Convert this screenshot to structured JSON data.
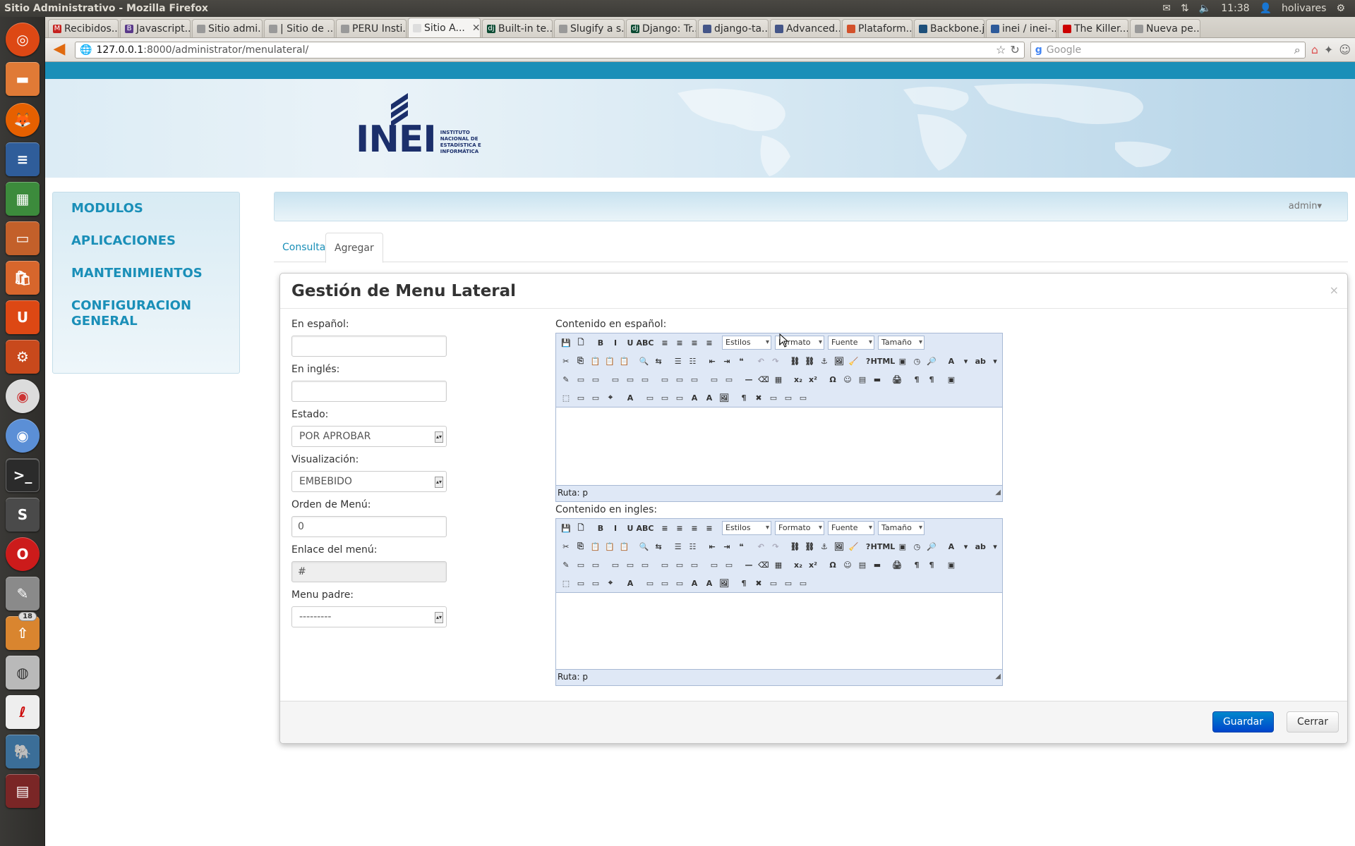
{
  "os": {
    "window_title": "Sitio Administrativo - Mozilla Firefox",
    "time": "11:38",
    "user": "holivares",
    "launcher_badge": "18"
  },
  "browser": {
    "tabs": [
      {
        "label": "Recibidos...",
        "fav": "M",
        "fav_color": "#c5221f"
      },
      {
        "label": "Javascript...",
        "fav": "B",
        "fav_color": "#5a3a8a"
      },
      {
        "label": "Sitio admi...",
        "fav": "",
        "fav_color": "#999999"
      },
      {
        "label": "| Sitio de ...",
        "fav": "",
        "fav_color": "#999999"
      },
      {
        "label": "PERU Insti...",
        "fav": "",
        "fav_color": "#999999"
      },
      {
        "label": "Sitio A...",
        "fav": "",
        "fav_color": "#dddddd",
        "active": true
      },
      {
        "label": "Built-in te...",
        "fav": "dj",
        "fav_color": "#0c4b33"
      },
      {
        "label": "Slugify a s...",
        "fav": "",
        "fav_color": "#999999"
      },
      {
        "label": "Django: Tr...",
        "fav": "dj",
        "fav_color": "#0c4b33"
      },
      {
        "label": "django-ta...",
        "fav": "",
        "fav_color": "#445588"
      },
      {
        "label": "Advanced...",
        "fav": "",
        "fav_color": "#445588"
      },
      {
        "label": "Plataform...",
        "fav": "",
        "fav_color": "#d3512b"
      },
      {
        "label": "Backbone.js",
        "fav": "",
        "fav_color": "#1d4f7a"
      },
      {
        "label": "inei / inei-...",
        "fav": "",
        "fav_color": "#2d5a9a"
      },
      {
        "label": "The Killer...",
        "fav": "",
        "fav_color": "#cc0000"
      },
      {
        "label": "Nueva pe...",
        "fav": "",
        "fav_color": "#999999"
      }
    ],
    "url_host": "127.0.0.1",
    "url_rest": ":8000/administrator/menulateral/",
    "search_placeholder": "Google"
  },
  "site": {
    "logo_text": "INEI",
    "logo_sub": "INSTITUTO NACIONAL DE ESTADÍSTICA E INFORMÁTICA",
    "sidebar": [
      {
        "label": "MODULOS"
      },
      {
        "label": "APLICACIONES"
      },
      {
        "label": "MANTENIMIENTOS"
      },
      {
        "label": "CONFIGURACION GENERAL"
      }
    ],
    "user_menu": "admin",
    "tabs": [
      {
        "label": "Consultar"
      },
      {
        "label": "Agregar",
        "active": true
      }
    ]
  },
  "modal": {
    "title": "Gestión de Menu Lateral",
    "close": "×",
    "fields": {
      "es_label": "En español:",
      "es_value": "",
      "en_label": "En inglés:",
      "en_value": "",
      "estado_label": "Estado:",
      "estado_value": "POR APROBAR",
      "visual_label": "Visualización:",
      "visual_value": "EMBEBIDO",
      "orden_label": "Orden de Menú:",
      "orden_value": "0",
      "enlace_label": "Enlace del menú:",
      "enlace_value": "#",
      "padre_label": "Menu padre:",
      "padre_value": "---------"
    },
    "editor_es_label": "Contenido en español:",
    "editor_en_label": "Contenido en ingles:",
    "editor_combos": [
      "Estilos",
      "Formato",
      "Fuente",
      "Tamaño"
    ],
    "editor_path": "Ruta: p",
    "save_label": "Guardar",
    "close_label": "Cerrar"
  }
}
